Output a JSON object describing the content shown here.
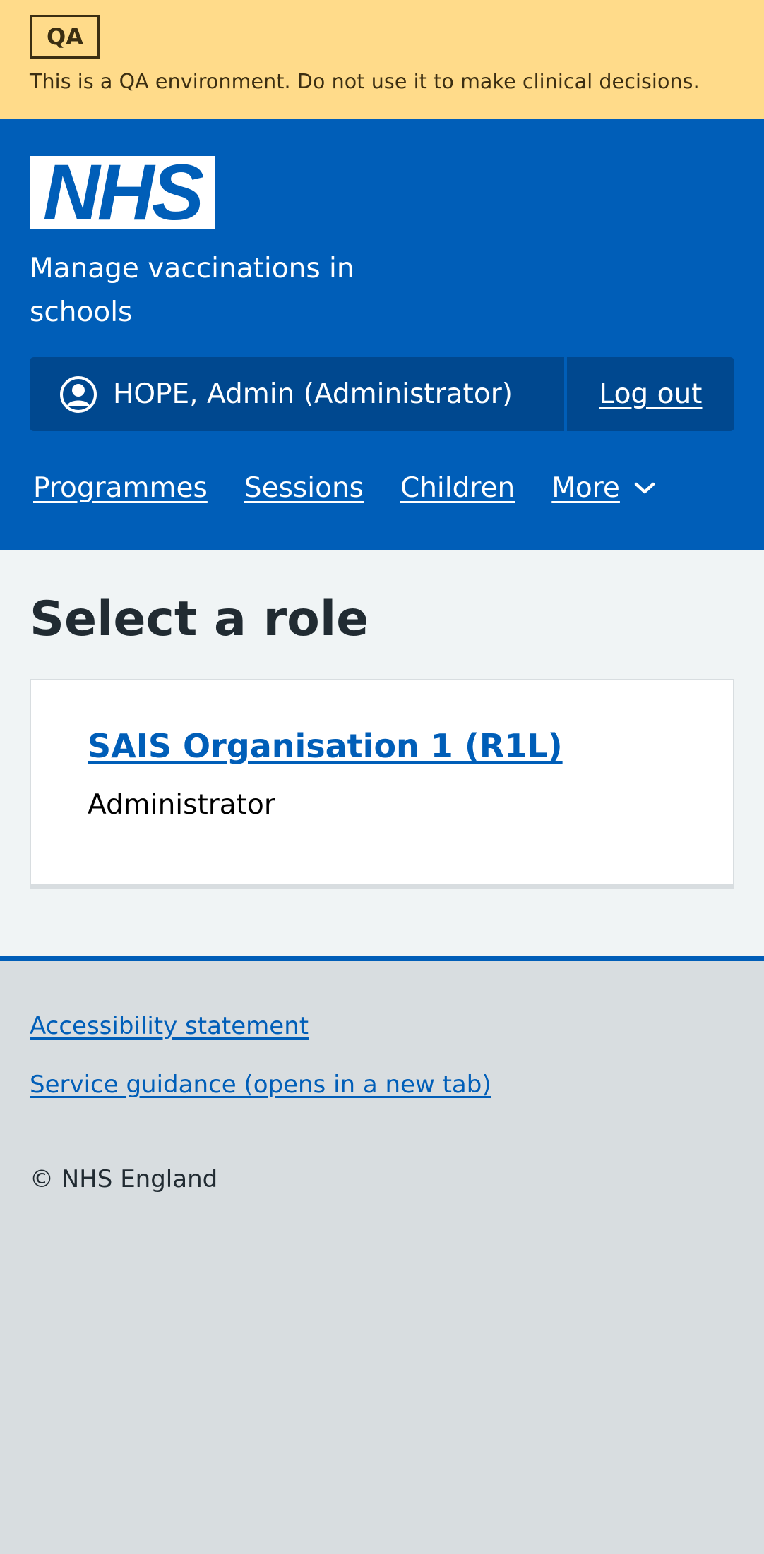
{
  "environment": {
    "tag": "QA",
    "message": "This is a QA environment. Do not use it to make clinical decisions.",
    "background_color": "#ffdb8a"
  },
  "header": {
    "logo_text": "NHS",
    "service_name": "Manage vaccinations in schools",
    "account": {
      "user_icon": "user-circle-icon",
      "user_label": "HOPE, Admin (Administrator)",
      "logout_label": "Log out"
    },
    "nav": {
      "items": [
        "Programmes",
        "Sessions",
        "Children"
      ],
      "more_label": "More",
      "more_icon": "chevron-down-icon"
    },
    "brand_color": "#005eb8"
  },
  "main": {
    "title": "Select a role",
    "cards": [
      {
        "organisation": "SAIS Organisation 1 (R1L)",
        "role": "Administrator"
      }
    ]
  },
  "footer": {
    "links": [
      "Accessibility statement",
      "Service guidance (opens in a new tab)"
    ],
    "copyright": "© NHS England"
  }
}
